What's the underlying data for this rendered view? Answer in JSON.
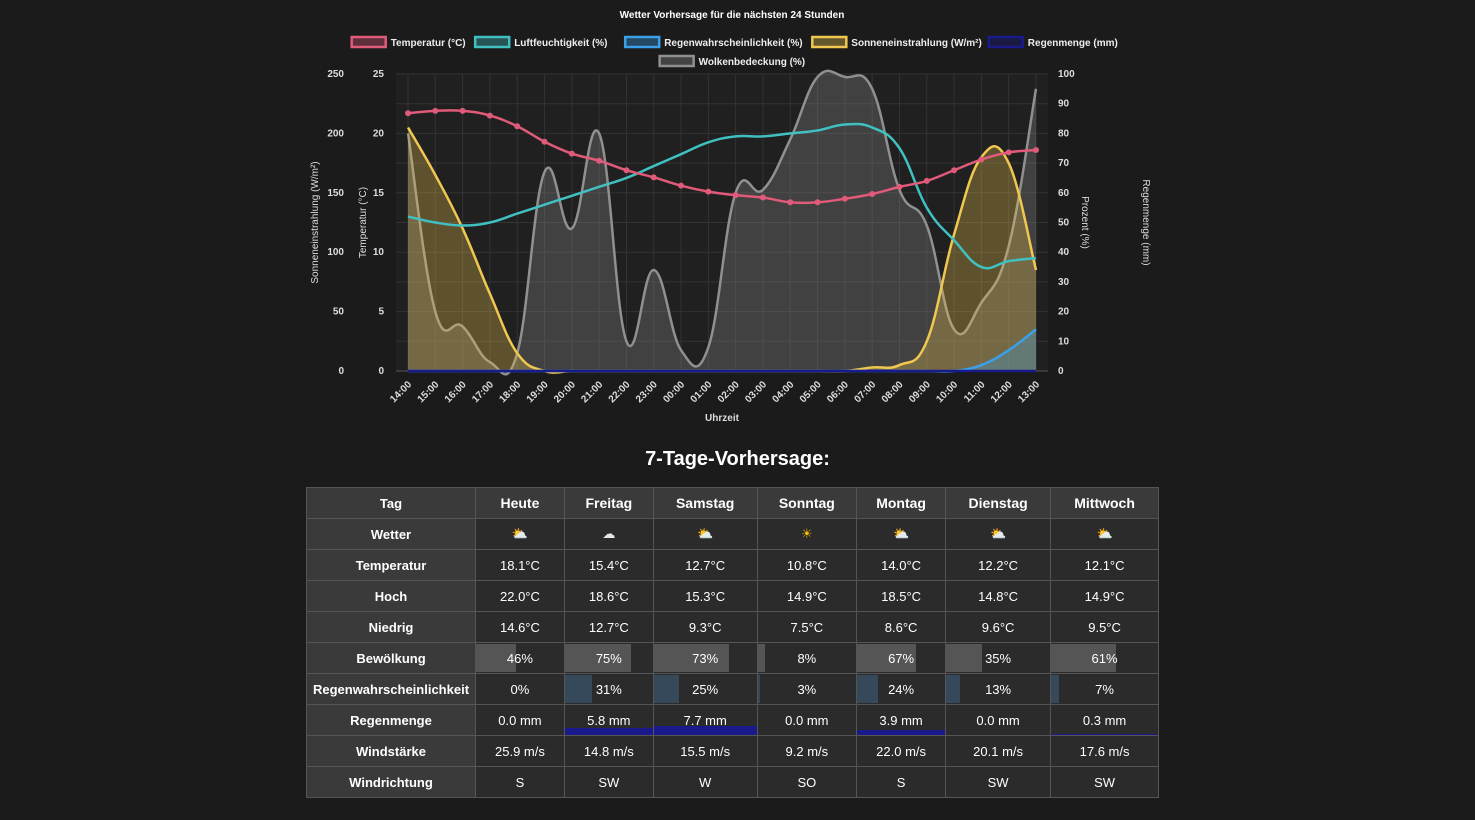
{
  "chart_data": {
    "type": "line",
    "title": "Wetter Vorhersage für die nächsten 24 Stunden",
    "xlabel": "Uhrzeit",
    "x": [
      "14:00",
      "15:00",
      "16:00",
      "17:00",
      "18:00",
      "19:00",
      "20:00",
      "21:00",
      "22:00",
      "23:00",
      "00:00",
      "01:00",
      "02:00",
      "03:00",
      "04:00",
      "05:00",
      "06:00",
      "07:00",
      "08:00",
      "09:00",
      "10:00",
      "11:00",
      "12:00",
      "13:00"
    ],
    "axes": {
      "sun": {
        "label": "Sonneneinstrahlung (W/m²)",
        "range": [
          0,
          250
        ],
        "ticks": [
          0,
          50,
          100,
          150,
          200,
          250
        ]
      },
      "temp": {
        "label": "Temperatur (°C)",
        "range": [
          0,
          25
        ],
        "ticks": [
          0,
          5,
          10,
          15,
          20,
          25
        ]
      },
      "pct": {
        "label": "Prozent (%)",
        "range": [
          0,
          100
        ],
        "ticks": [
          0,
          10,
          20,
          30,
          40,
          50,
          60,
          70,
          80,
          90,
          100
        ]
      },
      "rain": {
        "label": "Regenmenge (mm)"
      }
    },
    "series": [
      {
        "name": "Temperatur (°C)",
        "axis": "temp",
        "color": "#e05a7a",
        "points": true,
        "values": [
          21.7,
          21.9,
          21.9,
          21.5,
          20.6,
          19.3,
          18.3,
          17.7,
          16.9,
          16.3,
          15.6,
          15.1,
          14.8,
          14.6,
          14.2,
          14.2,
          14.5,
          14.9,
          15.5,
          16.0,
          16.9,
          17.8,
          18.4,
          18.6
        ]
      },
      {
        "name": "Luftfeuchtigkeit (%)",
        "axis": "pct",
        "color": "#40c0c0",
        "values": [
          52,
          50,
          49,
          50,
          53,
          56,
          59,
          62,
          65,
          69,
          73,
          77,
          79,
          79,
          80,
          81,
          83,
          82,
          75,
          55,
          44,
          35,
          37,
          38
        ]
      },
      {
        "name": "Regenwahrscheinlichkeit (%)",
        "axis": "pct",
        "color": "#3aa0e8",
        "fill": true,
        "values": [
          0,
          0,
          0,
          0,
          0,
          0,
          0,
          0,
          0,
          0,
          0,
          0,
          0,
          0,
          0,
          0,
          0,
          0,
          0,
          0,
          0,
          2,
          7,
          14
        ]
      },
      {
        "name": "Sonneneinstrahlung (W/m²)",
        "axis": "sun",
        "color": "#f0c850",
        "fill": true,
        "values": [
          205,
          165,
          120,
          65,
          15,
          0,
          0,
          0,
          0,
          0,
          0,
          0,
          0,
          0,
          0,
          0,
          0,
          3,
          5,
          25,
          115,
          180,
          175,
          85
        ]
      },
      {
        "name": "Regenmenge (mm)",
        "axis": "rain",
        "color": "#1a1a8c",
        "fill": true,
        "values": [
          0,
          0,
          0,
          0,
          0,
          0,
          0,
          0,
          0,
          0,
          0,
          0,
          0,
          0,
          0,
          0,
          0,
          0,
          0,
          0,
          0,
          0,
          0,
          0
        ]
      },
      {
        "name": "Wolkenbedeckung (%)",
        "axis": "pct",
        "color": "#909090",
        "fill": true,
        "values": [
          80,
          20,
          15,
          3,
          6,
          67,
          48,
          80,
          10,
          34,
          7,
          8,
          60,
          61,
          78,
          99,
          99,
          95,
          61,
          49,
          14,
          23,
          42,
          95
        ]
      }
    ]
  },
  "forecast": {
    "title": "7-Tage-Vorhersage:",
    "corner": "Tag",
    "days": [
      {
        "name": "Heute",
        "icon": "partly-cloudy",
        "temp": "18.1°C",
        "high": "22.0°C",
        "low": "14.6°C",
        "cloud": "46%",
        "cloud_pct": 46,
        "rain_prob": "0%",
        "rain_prob_pct": 0,
        "rain": "0.0 mm",
        "rain_mm": 0.0,
        "wind": "25.9 m/s",
        "dir": "S"
      },
      {
        "name": "Freitag",
        "icon": "cloudy",
        "temp": "15.4°C",
        "high": "18.6°C",
        "low": "12.7°C",
        "cloud": "75%",
        "cloud_pct": 75,
        "rain_prob": "31%",
        "rain_prob_pct": 31,
        "rain": "5.8 mm",
        "rain_mm": 5.8,
        "wind": "14.8 m/s",
        "dir": "SW"
      },
      {
        "name": "Samstag",
        "icon": "partly-cloudy",
        "temp": "12.7°C",
        "high": "15.3°C",
        "low": "9.3°C",
        "cloud": "73%",
        "cloud_pct": 73,
        "rain_prob": "25%",
        "rain_prob_pct": 25,
        "rain": "7.7 mm",
        "rain_mm": 7.7,
        "wind": "15.5 m/s",
        "dir": "W"
      },
      {
        "name": "Sonntag",
        "icon": "sunny",
        "temp": "10.8°C",
        "high": "14.9°C",
        "low": "7.5°C",
        "cloud": "8%",
        "cloud_pct": 8,
        "rain_prob": "3%",
        "rain_prob_pct": 3,
        "rain": "0.0 mm",
        "rain_mm": 0.0,
        "wind": "9.2 m/s",
        "dir": "SO"
      },
      {
        "name": "Montag",
        "icon": "partly-cloudy",
        "temp": "14.0°C",
        "high": "18.5°C",
        "low": "8.6°C",
        "cloud": "67%",
        "cloud_pct": 67,
        "rain_prob": "24%",
        "rain_prob_pct": 24,
        "rain": "3.9 mm",
        "rain_mm": 3.9,
        "wind": "22.0 m/s",
        "dir": "S"
      },
      {
        "name": "Dienstag",
        "icon": "partly-cloudy",
        "temp": "12.2°C",
        "high": "14.8°C",
        "low": "9.6°C",
        "cloud": "35%",
        "cloud_pct": 35,
        "rain_prob": "13%",
        "rain_prob_pct": 13,
        "rain": "0.0 mm",
        "rain_mm": 0.0,
        "wind": "20.1 m/s",
        "dir": "SW"
      },
      {
        "name": "Mittwoch",
        "icon": "partly-cloudy",
        "temp": "12.1°C",
        "high": "14.9°C",
        "low": "9.5°C",
        "cloud": "61%",
        "cloud_pct": 61,
        "rain_prob": "7%",
        "rain_prob_pct": 7,
        "rain": "0.3 mm",
        "rain_mm": 0.3,
        "wind": "17.6 m/s",
        "dir": "SW"
      }
    ],
    "rows": [
      {
        "key": "icon",
        "label": "Wetter"
      },
      {
        "key": "temp",
        "label": "Temperatur"
      },
      {
        "key": "high",
        "label": "Hoch"
      },
      {
        "key": "low",
        "label": "Niedrig"
      },
      {
        "key": "cloud",
        "label": "Bewölkung",
        "bar": "cloud_pct",
        "bar_color": "#555555"
      },
      {
        "key": "rain_prob",
        "label": "Regenwahrscheinlichkeit",
        "bar": "rain_prob_pct",
        "bar_color": "#36495a"
      },
      {
        "key": "rain",
        "label": "Regenmenge",
        "rainbar": "rain_mm"
      },
      {
        "key": "wind",
        "label": "Windstärke"
      },
      {
        "key": "dir",
        "label": "Windrichtung"
      }
    ],
    "icons": {
      "partly-cloudy": "⛅",
      "cloudy": "☁",
      "sunny": "☀"
    },
    "icon_colors": {
      "partly-cloudy": "#f5c542",
      "cloudy": "#e8e8e8",
      "sunny": "#f5b800"
    }
  }
}
